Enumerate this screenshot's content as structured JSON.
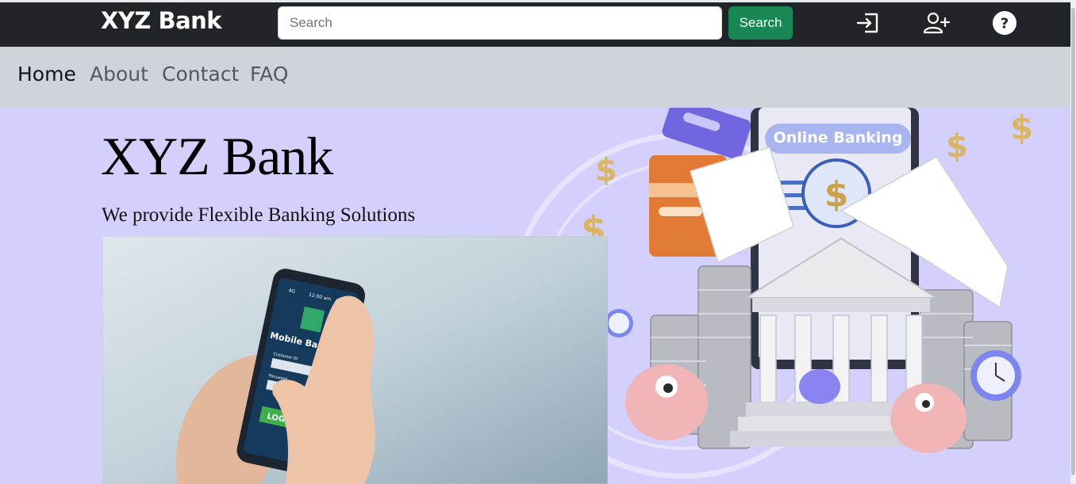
{
  "navbar": {
    "brand": "XYZ Bank",
    "search_placeholder": "Search",
    "search_button": "Search",
    "icons": [
      "login-icon",
      "add-user-icon",
      "help-icon"
    ]
  },
  "subnav": {
    "items": [
      {
        "label": "Home",
        "active": true
      },
      {
        "label": "About",
        "active": false
      },
      {
        "label": "Contact",
        "active": false
      },
      {
        "label": "FAQ",
        "active": false
      }
    ]
  },
  "hero": {
    "title": "XYZ Bank",
    "subtitle": "We provide Flexible Banking Solutions",
    "illustration_label": "Online  Banking",
    "phone": {
      "screen_title": "Mobile Banking",
      "time": "12:00 am",
      "network": "4G",
      "customer_id_label": "Customer ID",
      "password_label": "Password",
      "login_label": "LOGIN"
    },
    "background_color": "#d3d0fd"
  },
  "colors": {
    "navbar_bg": "#212529",
    "subnav_bg": "#cfd4da",
    "search_button": "#198754"
  }
}
